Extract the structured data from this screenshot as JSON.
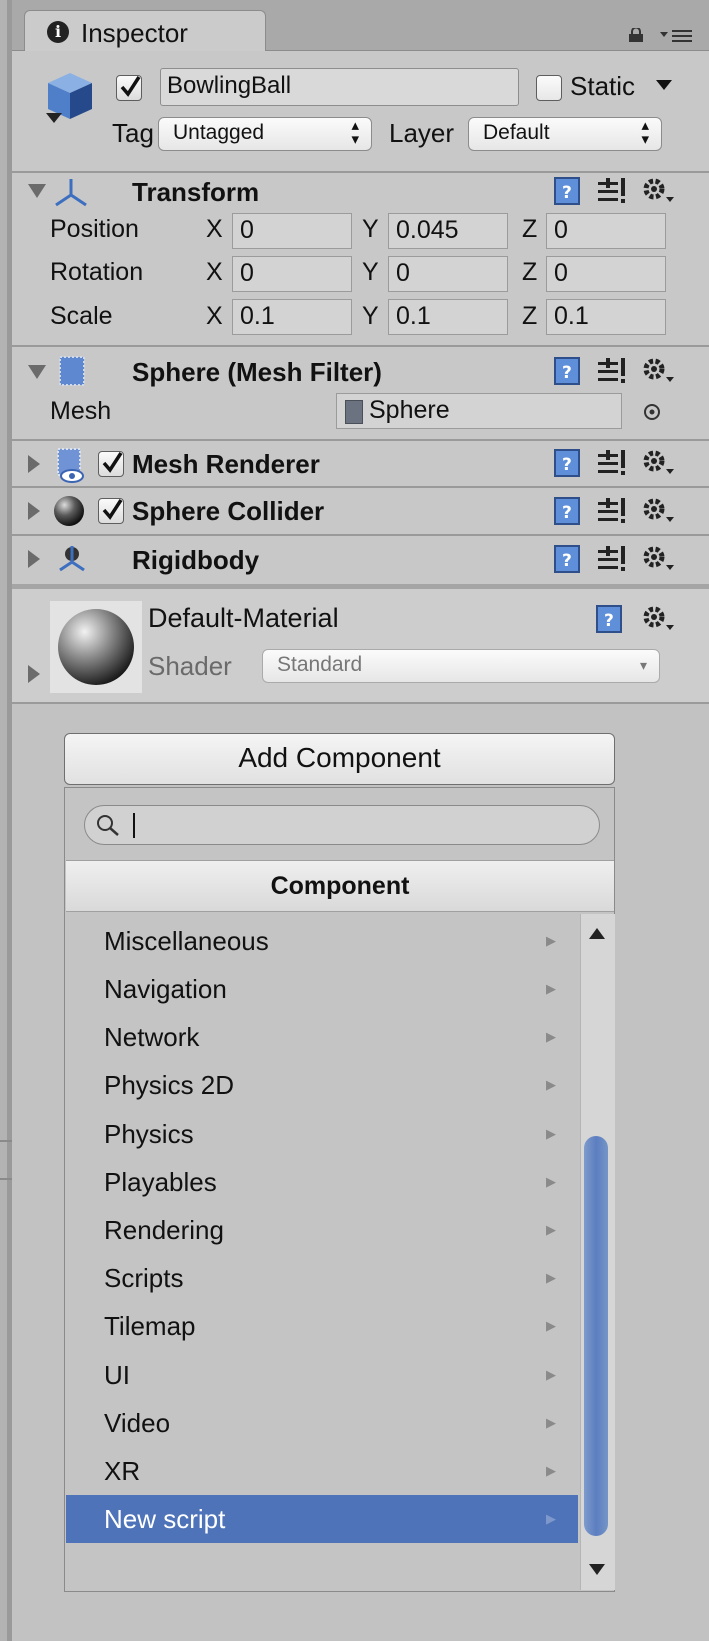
{
  "tab": {
    "title": "Inspector"
  },
  "object": {
    "name": "BowlingBall",
    "active": true,
    "static_label": "Static",
    "static_checked": false,
    "tag_label": "Tag",
    "tag_value": "Untagged",
    "layer_label": "Layer",
    "layer_value": "Default"
  },
  "transform": {
    "title": "Transform",
    "rows": [
      {
        "label": "Position",
        "x": "0",
        "y": "0.045",
        "z": "0"
      },
      {
        "label": "Rotation",
        "x": "0",
        "y": "0",
        "z": "0"
      },
      {
        "label": "Scale",
        "x": "0.1",
        "y": "0.1",
        "z": "0.1"
      }
    ],
    "axis_x": "X",
    "axis_y": "Y",
    "axis_z": "Z"
  },
  "mesh_filter": {
    "title": "Sphere (Mesh Filter)",
    "mesh_label": "Mesh",
    "mesh_value": "Sphere"
  },
  "components": [
    {
      "title": "Mesh Renderer",
      "enabled": true
    },
    {
      "title": "Sphere Collider",
      "enabled": true
    },
    {
      "title": "Rigidbody"
    }
  ],
  "material": {
    "name": "Default-Material",
    "shader_label": "Shader",
    "shader_value": "Standard"
  },
  "add_component": {
    "button_label": "Add Component",
    "search_value": "",
    "header": "Component",
    "items": [
      "Miscellaneous",
      "Navigation",
      "Network",
      "Physics 2D",
      "Physics",
      "Playables",
      "Rendering",
      "Scripts",
      "Tilemap",
      "UI",
      "Video",
      "XR",
      "New script"
    ],
    "selected_index": 12
  },
  "colors": {
    "selection": "#4e73b9",
    "panel": "#c8c8c8",
    "scroll_thumb": "#5c7ec0"
  }
}
